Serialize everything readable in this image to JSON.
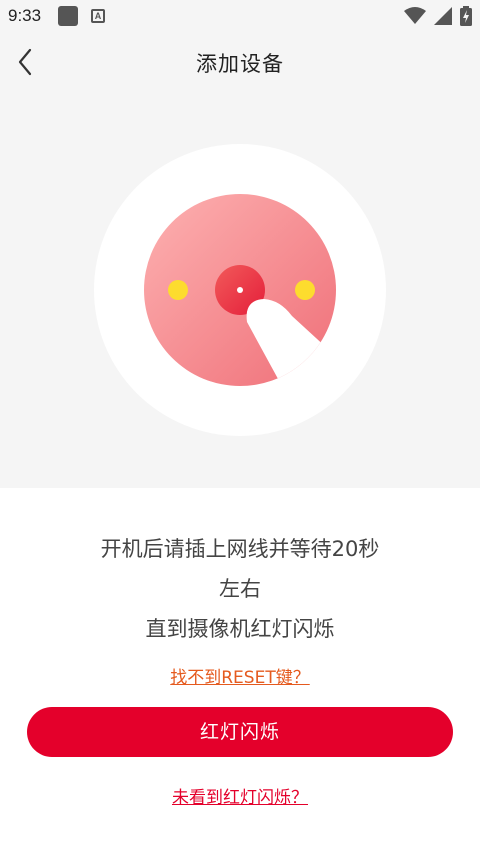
{
  "status_bar": {
    "time": "9:33",
    "a_badge": "A",
    "icons": [
      "notification-square-icon",
      "a-badge-icon",
      "wifi-icon",
      "signal-icon",
      "battery-charging-icon"
    ]
  },
  "header": {
    "title": "添加设备",
    "back_icon": "chevron-left-icon"
  },
  "instructions": {
    "line1": "开机后请插上网线并等待20秒",
    "line2": "左右",
    "line3": "直到摄像机红灯闪烁"
  },
  "links": {
    "reset": "找不到RESET键？",
    "not_see": "未看到红灯闪烁？"
  },
  "primary_button": {
    "label": "红灯闪烁"
  },
  "colors": {
    "brand_red": "#e4002b",
    "link_orange": "#e55a1e",
    "hero_bg": "#f5f5f5"
  }
}
